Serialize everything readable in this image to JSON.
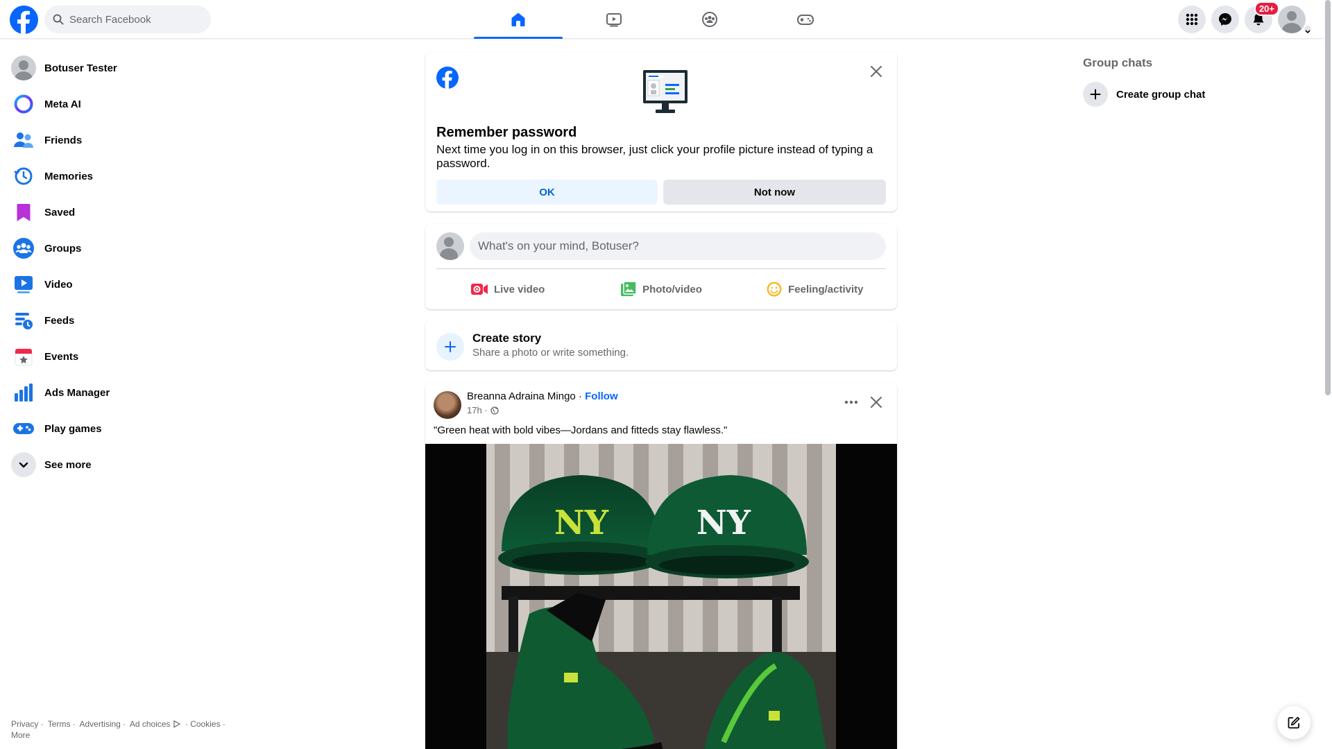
{
  "topbar": {
    "search_placeholder": "Search Facebook",
    "tabs": [
      "home",
      "video",
      "groups",
      "gaming"
    ],
    "active_tab": "home",
    "notifications_badge": "20+"
  },
  "sidebar": {
    "items": [
      {
        "label": "Botuser Tester",
        "icon": "avatar"
      },
      {
        "label": "Meta AI",
        "icon": "meta-ai-icon"
      },
      {
        "label": "Friends",
        "icon": "friends-icon"
      },
      {
        "label": "Memories",
        "icon": "memories-icon"
      },
      {
        "label": "Saved",
        "icon": "saved-icon"
      },
      {
        "label": "Groups",
        "icon": "groups-icon"
      },
      {
        "label": "Video",
        "icon": "video-icon"
      },
      {
        "label": "Feeds",
        "icon": "feeds-icon"
      },
      {
        "label": "Events",
        "icon": "events-icon"
      },
      {
        "label": "Ads Manager",
        "icon": "ads-manager-icon"
      },
      {
        "label": "Play games",
        "icon": "play-games-icon"
      },
      {
        "label": "See more",
        "icon": "chevron-down-icon"
      }
    ]
  },
  "footer": {
    "links": [
      "Privacy ·",
      "Terms ·",
      "Advertising ·",
      "Ad choices",
      "· Cookies ·",
      "More"
    ]
  },
  "remember_password": {
    "title": "Remember password",
    "body": "Next time you log in on this browser, just click your profile picture instead of typing a password.",
    "ok_label": "OK",
    "not_now_label": "Not now"
  },
  "composer": {
    "placeholder": "What's on your mind, Botuser?",
    "actions": [
      "Live video",
      "Photo/video",
      "Feeling/activity"
    ]
  },
  "story": {
    "title": "Create story",
    "subtitle": "Share a photo or write something."
  },
  "post": {
    "author": "Breanna Adraina Mingo",
    "separator": " · ",
    "follow_label": "Follow",
    "time": "17h ·",
    "text": "\"Green heat with bold vibes—Jordans and fitteds stay flawless.\""
  },
  "right": {
    "group_chats_title": "Group chats",
    "create_group_chat": "Create group chat"
  },
  "colors": {
    "brand": "#0866ff",
    "badge": "#e41e3f",
    "secondary_text": "#65676b"
  }
}
